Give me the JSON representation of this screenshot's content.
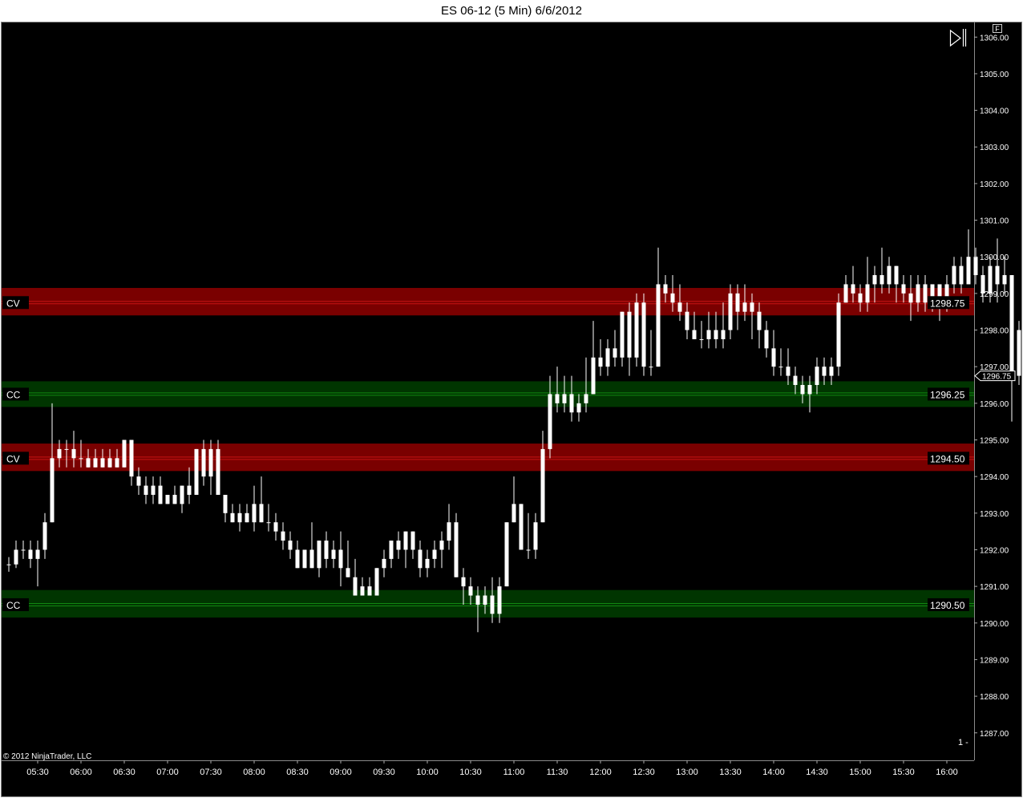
{
  "window": {
    "title": "ES 06-12 (5 Min)  6/6/2012"
  },
  "footer": {
    "copyright": "© 2012 NinjaTrader, LLC"
  },
  "controls": {
    "f_label": "F",
    "panel_number": "1 -"
  },
  "colors": {
    "background": "#000000",
    "candle": "#ffffff",
    "cv_zone": "#7a0000",
    "cv_line": "#c81414",
    "cc_zone": "#003500",
    "cc_line": "#118811",
    "text": "#ffffff"
  },
  "chart_data": {
    "type": "candlestick",
    "title": "ES 06-12 (5 Min)  6/6/2012",
    "xlabel": "",
    "ylabel": "",
    "ylim": [
      1286.25,
      1306.4
    ],
    "y_ticks": [
      "1287.00",
      "1288.00",
      "1289.00",
      "1290.00",
      "1291.00",
      "1292.00",
      "1293.00",
      "1294.00",
      "1295.00",
      "1296.00",
      "1297.00",
      "1298.00",
      "1299.00",
      "1300.00",
      "1301.00",
      "1302.00",
      "1303.00",
      "1304.00",
      "1305.00",
      "1306.00"
    ],
    "x_ticks": [
      "05:30",
      "06:00",
      "06:30",
      "07:00",
      "07:30",
      "08:00",
      "08:30",
      "09:00",
      "09:30",
      "10:00",
      "10:30",
      "11:00",
      "11:30",
      "12:00",
      "12:30",
      "13:00",
      "13:30",
      "14:00",
      "14:30",
      "15:00",
      "15:30",
      "16:00"
    ],
    "x_start": "05:10",
    "interval_minutes": 5,
    "last_price": "1296.75",
    "zones": [
      {
        "label": "CV",
        "value_text": "1298.75",
        "value": 1298.75,
        "low": 1298.4,
        "high": 1299.15,
        "kind": "cv"
      },
      {
        "label": "CC",
        "value_text": "1296.25",
        "value": 1296.25,
        "low": 1295.9,
        "high": 1296.6,
        "kind": "cc"
      },
      {
        "label": "CV",
        "value_text": "1294.50",
        "value": 1294.5,
        "low": 1294.15,
        "high": 1294.9,
        "kind": "cv"
      },
      {
        "label": "CC",
        "value_text": "1290.50",
        "value": 1290.5,
        "low": 1290.15,
        "high": 1290.9,
        "kind": "cc"
      }
    ],
    "candles": [
      [
        1291.6,
        1291.8,
        1291.4,
        1291.6
      ],
      [
        1291.6,
        1292.25,
        1291.5,
        1292.0
      ],
      [
        1292.0,
        1292.25,
        1291.75,
        1292.0
      ],
      [
        1292.0,
        1292.25,
        1291.5,
        1291.75
      ],
      [
        1291.75,
        1292.25,
        1291.0,
        1292.0
      ],
      [
        1292.0,
        1293.0,
        1291.75,
        1292.75
      ],
      [
        1292.75,
        1296.0,
        1292.75,
        1294.5
      ],
      [
        1294.5,
        1295.0,
        1294.25,
        1294.75
      ],
      [
        1294.75,
        1295.0,
        1294.25,
        1294.75
      ],
      [
        1294.75,
        1295.25,
        1294.25,
        1294.5
      ],
      [
        1294.5,
        1295.0,
        1294.25,
        1294.5
      ],
      [
        1294.5,
        1294.75,
        1294.25,
        1294.25
      ],
      [
        1294.25,
        1294.75,
        1294.25,
        1294.5
      ],
      [
        1294.5,
        1294.75,
        1294.25,
        1294.25
      ],
      [
        1294.25,
        1294.75,
        1294.25,
        1294.5
      ],
      [
        1294.5,
        1294.75,
        1294.25,
        1294.25
      ],
      [
        1294.25,
        1295.0,
        1294.25,
        1295.0
      ],
      [
        1295.0,
        1295.0,
        1293.75,
        1294.0
      ],
      [
        1294.0,
        1294.25,
        1293.5,
        1293.75
      ],
      [
        1293.75,
        1294.0,
        1293.25,
        1293.5
      ],
      [
        1293.5,
        1294.0,
        1293.25,
        1293.75
      ],
      [
        1293.75,
        1294.0,
        1293.25,
        1293.25
      ],
      [
        1293.25,
        1293.5,
        1293.25,
        1293.5
      ],
      [
        1293.5,
        1293.75,
        1293.25,
        1293.25
      ],
      [
        1293.25,
        1293.75,
        1293.0,
        1293.75
      ],
      [
        1293.75,
        1294.25,
        1293.25,
        1293.5
      ],
      [
        1293.5,
        1294.75,
        1293.5,
        1294.75
      ],
      [
        1294.75,
        1295.0,
        1293.75,
        1294.0
      ],
      [
        1294.0,
        1295.0,
        1293.5,
        1294.75
      ],
      [
        1294.75,
        1295.0,
        1293.5,
        1293.5
      ],
      [
        1293.5,
        1293.5,
        1292.75,
        1293.0
      ],
      [
        1293.0,
        1293.25,
        1292.75,
        1292.75
      ],
      [
        1292.75,
        1293.25,
        1292.5,
        1293.0
      ],
      [
        1293.0,
        1293.25,
        1292.75,
        1292.75
      ],
      [
        1292.75,
        1293.75,
        1292.5,
        1293.25
      ],
      [
        1293.25,
        1294.0,
        1292.75,
        1292.75
      ],
      [
        1292.75,
        1293.25,
        1292.5,
        1292.75
      ],
      [
        1292.75,
        1293.0,
        1292.25,
        1292.5
      ],
      [
        1292.5,
        1292.75,
        1292.0,
        1292.25
      ],
      [
        1292.25,
        1292.5,
        1291.75,
        1292.0
      ],
      [
        1292.0,
        1292.25,
        1291.5,
        1291.5
      ],
      [
        1291.5,
        1292.0,
        1291.5,
        1292.0
      ],
      [
        1292.0,
        1292.75,
        1291.5,
        1291.5
      ],
      [
        1291.5,
        1292.25,
        1291.25,
        1292.25
      ],
      [
        1292.25,
        1292.5,
        1291.5,
        1291.75
      ],
      [
        1291.75,
        1292.25,
        1291.5,
        1292.0
      ],
      [
        1292.0,
        1292.5,
        1291.0,
        1291.5
      ],
      [
        1291.5,
        1292.25,
        1291.25,
        1291.25
      ],
      [
        1291.25,
        1291.75,
        1291.0,
        1290.75
      ],
      [
        1290.75,
        1291.25,
        1290.75,
        1291.0
      ],
      [
        1291.0,
        1291.25,
        1290.75,
        1290.75
      ],
      [
        1290.75,
        1291.5,
        1290.75,
        1291.5
      ],
      [
        1291.5,
        1292.0,
        1291.25,
        1291.75
      ],
      [
        1291.75,
        1292.25,
        1291.5,
        1292.25
      ],
      [
        1292.25,
        1292.5,
        1291.75,
        1292.0
      ],
      [
        1292.0,
        1292.5,
        1291.5,
        1292.5
      ],
      [
        1292.5,
        1292.5,
        1291.75,
        1292.0
      ],
      [
        1292.0,
        1292.25,
        1291.25,
        1291.5
      ],
      [
        1291.5,
        1292.0,
        1291.25,
        1291.75
      ],
      [
        1291.75,
        1292.25,
        1291.5,
        1292.0
      ],
      [
        1292.0,
        1292.5,
        1291.5,
        1292.25
      ],
      [
        1292.25,
        1293.25,
        1292.0,
        1292.75
      ],
      [
        1292.75,
        1293.0,
        1291.25,
        1291.25
      ],
      [
        1291.25,
        1291.5,
        1290.5,
        1291.0
      ],
      [
        1291.0,
        1291.25,
        1290.5,
        1290.75
      ],
      [
        1290.75,
        1291.0,
        1289.75,
        1290.5
      ],
      [
        1290.5,
        1291.0,
        1290.25,
        1290.75
      ],
      [
        1290.75,
        1291.25,
        1290.0,
        1290.25
      ],
      [
        1290.25,
        1291.25,
        1290.0,
        1291.0
      ],
      [
        1291.0,
        1292.75,
        1291.0,
        1292.75
      ],
      [
        1292.75,
        1294.0,
        1292.75,
        1293.25
      ],
      [
        1293.25,
        1293.25,
        1292.0,
        1292.0
      ],
      [
        1292.0,
        1293.0,
        1291.75,
        1292.0
      ],
      [
        1292.0,
        1293.0,
        1291.75,
        1292.75
      ],
      [
        1292.75,
        1295.25,
        1292.75,
        1294.75
      ],
      [
        1294.75,
        1296.75,
        1294.5,
        1296.25
      ],
      [
        1296.25,
        1297.0,
        1295.75,
        1296.0
      ],
      [
        1296.0,
        1296.75,
        1295.75,
        1296.25
      ],
      [
        1296.25,
        1296.75,
        1295.5,
        1295.75
      ],
      [
        1295.75,
        1296.25,
        1295.5,
        1296.0
      ],
      [
        1296.0,
        1297.25,
        1295.75,
        1296.25
      ],
      [
        1296.25,
        1298.25,
        1296.25,
        1297.25
      ],
      [
        1297.25,
        1297.75,
        1296.75,
        1297.0
      ],
      [
        1297.0,
        1297.75,
        1296.75,
        1297.5
      ],
      [
        1297.5,
        1298.0,
        1297.0,
        1297.25
      ],
      [
        1297.25,
        1298.5,
        1297.0,
        1298.5
      ],
      [
        1298.5,
        1298.75,
        1296.75,
        1297.25
      ],
      [
        1297.25,
        1299.0,
        1297.0,
        1298.75
      ],
      [
        1298.75,
        1299.0,
        1296.75,
        1297.0
      ],
      [
        1297.0,
        1298.0,
        1296.75,
        1297.0
      ],
      [
        1297.0,
        1300.25,
        1297.0,
        1299.25
      ],
      [
        1299.25,
        1299.5,
        1298.75,
        1299.0
      ],
      [
        1299.0,
        1299.5,
        1298.5,
        1298.75
      ],
      [
        1298.75,
        1299.25,
        1298.25,
        1298.5
      ],
      [
        1298.5,
        1298.75,
        1297.75,
        1298.0
      ],
      [
        1298.0,
        1298.5,
        1297.75,
        1297.75
      ],
      [
        1297.75,
        1298.25,
        1297.5,
        1297.75
      ],
      [
        1297.75,
        1298.5,
        1297.5,
        1298.0
      ],
      [
        1298.0,
        1298.5,
        1297.5,
        1297.75
      ],
      [
        1297.75,
        1298.75,
        1297.5,
        1298.0
      ],
      [
        1298.0,
        1299.25,
        1297.75,
        1299.0
      ],
      [
        1299.0,
        1299.25,
        1298.0,
        1298.5
      ],
      [
        1298.5,
        1299.25,
        1298.25,
        1298.75
      ],
      [
        1298.75,
        1299.0,
        1297.75,
        1298.5
      ],
      [
        1298.5,
        1298.75,
        1297.5,
        1298.0
      ],
      [
        1298.0,
        1298.25,
        1297.25,
        1297.5
      ],
      [
        1297.5,
        1298.0,
        1296.75,
        1297.0
      ],
      [
        1297.0,
        1297.5,
        1296.75,
        1297.0
      ],
      [
        1297.0,
        1297.5,
        1296.5,
        1296.75
      ],
      [
        1296.75,
        1297.0,
        1296.25,
        1296.5
      ],
      [
        1296.5,
        1296.75,
        1296.0,
        1296.25
      ],
      [
        1296.25,
        1296.75,
        1295.75,
        1296.5
      ],
      [
        1296.5,
        1297.25,
        1296.25,
        1297.0
      ],
      [
        1297.0,
        1297.25,
        1296.5,
        1296.75
      ],
      [
        1296.75,
        1297.25,
        1296.5,
        1297.0
      ],
      [
        1297.0,
        1299.0,
        1296.75,
        1298.75
      ],
      [
        1298.75,
        1299.5,
        1298.75,
        1299.25
      ],
      [
        1299.25,
        1299.75,
        1298.75,
        1299.0
      ],
      [
        1299.0,
        1299.25,
        1298.5,
        1298.75
      ],
      [
        1298.75,
        1300.0,
        1298.5,
        1299.25
      ],
      [
        1299.25,
        1299.75,
        1298.75,
        1299.5
      ],
      [
        1299.5,
        1300.25,
        1299.0,
        1299.25
      ],
      [
        1299.25,
        1300.0,
        1299.0,
        1299.75
      ],
      [
        1299.75,
        1299.75,
        1298.75,
        1299.25
      ],
      [
        1299.25,
        1299.5,
        1298.75,
        1299.0
      ],
      [
        1299.0,
        1299.5,
        1298.25,
        1298.75
      ],
      [
        1298.75,
        1299.5,
        1298.5,
        1299.25
      ],
      [
        1299.25,
        1299.5,
        1298.5,
        1298.75
      ],
      [
        1298.75,
        1299.25,
        1298.5,
        1299.25
      ],
      [
        1299.25,
        1299.25,
        1298.25,
        1298.75
      ],
      [
        1298.75,
        1299.5,
        1298.5,
        1299.25
      ],
      [
        1299.25,
        1300.0,
        1299.0,
        1299.75
      ],
      [
        1299.75,
        1300.0,
        1299.0,
        1299.25
      ],
      [
        1299.25,
        1300.75,
        1299.25,
        1300.0
      ],
      [
        1300.0,
        1300.25,
        1299.25,
        1299.5
      ],
      [
        1299.5,
        1299.75,
        1298.75,
        1299.0
      ],
      [
        1299.0,
        1300.0,
        1298.75,
        1299.75
      ],
      [
        1299.75,
        1300.5,
        1298.75,
        1299.25
      ],
      [
        1299.25,
        1300.0,
        1299.0,
        1299.5
      ],
      [
        1299.5,
        1299.5,
        1295.5,
        1296.75
      ],
      [
        1296.75,
        1298.25,
        1296.5,
        1298.0
      ],
      [
        1298.0,
        1298.25,
        1297.5,
        1297.75
      ],
      [
        1297.75,
        1297.75,
        1296.75,
        1297.5
      ]
    ]
  }
}
